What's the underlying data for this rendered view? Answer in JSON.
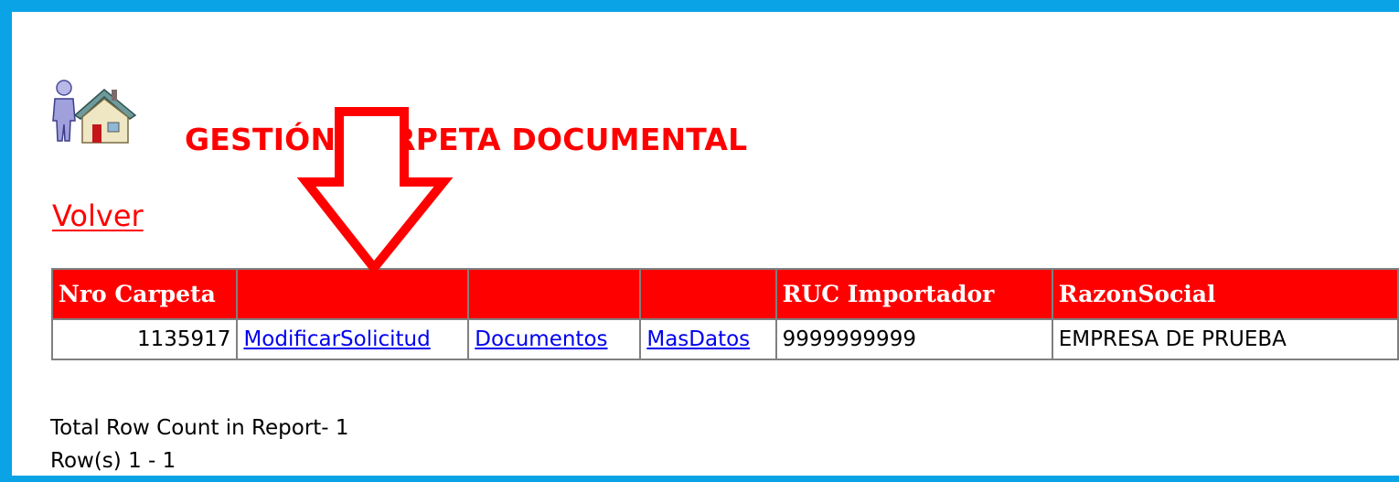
{
  "header": {
    "title": "GESTIÓN CARPETA DOCUMENTAL",
    "icon": "user-home-icon"
  },
  "nav": {
    "back_label": "Volver"
  },
  "report": {
    "columns": [
      "Nro Carpeta",
      "",
      "",
      "",
      "RUC Importador",
      "RazonSocial"
    ],
    "rows": [
      {
        "nro_carpeta": "1135917",
        "modificar_link": "ModificarSolicitud",
        "documentos_link": "Documentos",
        "masdatos_link": "MasDatos",
        "ruc": "9999999999",
        "razon_social": "EMPRESA DE PRUEBA"
      }
    ]
  },
  "footer": {
    "total_rows": "Total Row Count in Report- 1",
    "row_range": "Row(s) 1 - 1"
  },
  "annotation": {
    "arrow_icon": "down-arrow-icon",
    "color": "#ff0000"
  },
  "colors": {
    "frame": "#0aa3e6",
    "accent": "#ff0000",
    "link": "#0000ee",
    "grid": "#808080"
  }
}
